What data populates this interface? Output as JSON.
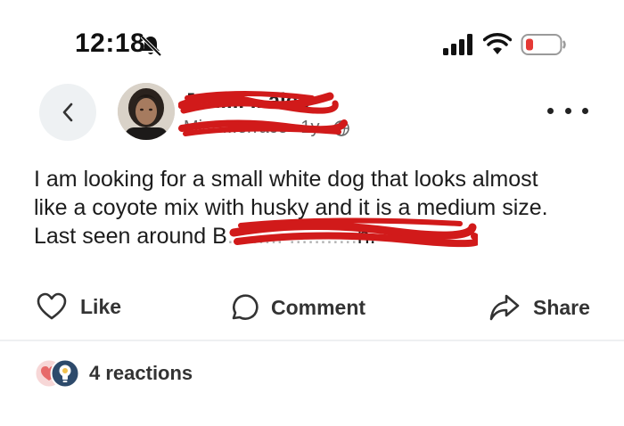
{
  "status_bar": {
    "time": "12:18",
    "icons": [
      "bell-muted-icon",
      "cellular-signal-icon",
      "wifi-icon",
      "battery-low-icon"
    ],
    "battery_color": "#e53935"
  },
  "post": {
    "author_name": "Jani... ...ales",
    "meta": {
      "location": "Mi... ...errace",
      "separator": "·",
      "age": "1y",
      "separator2": "·",
      "visibility_icon": "globe-icon"
    },
    "body": {
      "line1": "I am looking for a small white dog that looks almost",
      "line2": "like a coyote mix with husky and it is a medium size.",
      "line3_prefix": "Last seen around B",
      "line3_redacted": "......... ...........",
      "line3_suffix": "n."
    },
    "redaction_color": "#d11a1a"
  },
  "actions": {
    "like": "Like",
    "comment": "Comment",
    "share": "Share"
  },
  "reactions": {
    "count_label": "4 reactions",
    "icons": [
      "heart-reaction-icon",
      "lightbulb-reaction-icon"
    ]
  }
}
